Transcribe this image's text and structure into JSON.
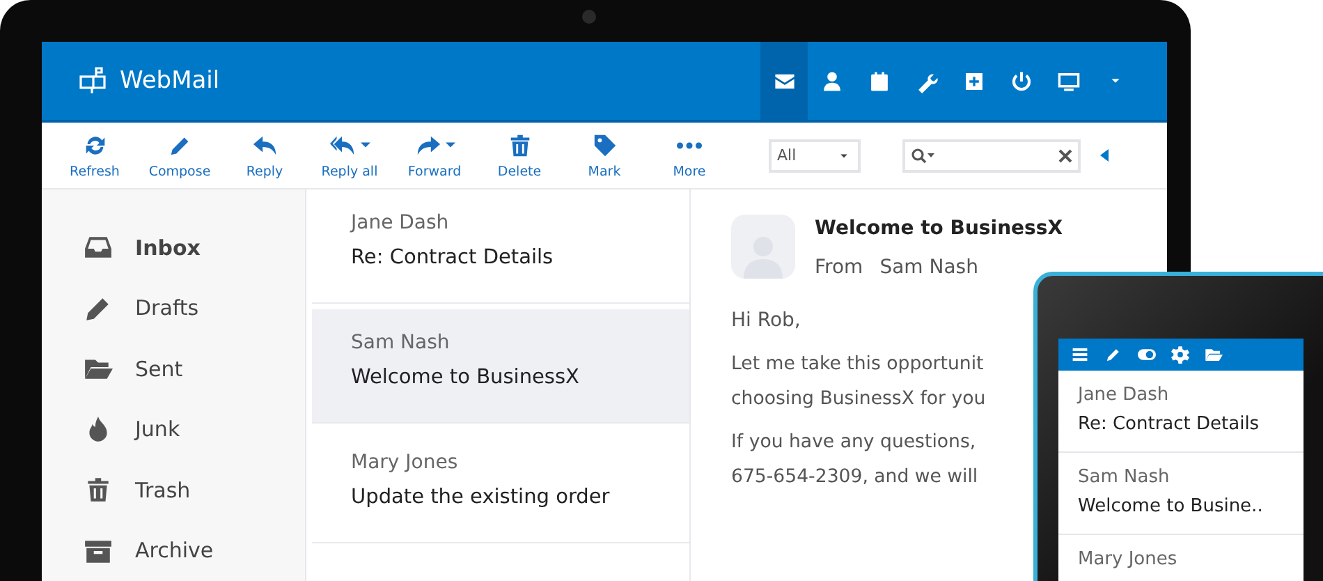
{
  "app": {
    "title": "WebMail"
  },
  "nav_icons": [
    {
      "kind": "mail",
      "selected": true
    },
    {
      "kind": "person",
      "selected": false
    },
    {
      "kind": "calendar",
      "selected": false
    },
    {
      "kind": "wrench",
      "selected": false
    },
    {
      "kind": "plus",
      "selected": false
    },
    {
      "kind": "power",
      "selected": false
    },
    {
      "kind": "monitor",
      "selected": false
    },
    {
      "kind": "caret",
      "selected": false
    }
  ],
  "toolbar": [
    {
      "kind": "refresh",
      "label": "Refresh",
      "dropdown": false
    },
    {
      "kind": "compose",
      "label": "Compose",
      "dropdown": false
    },
    {
      "kind": "reply",
      "label": "Reply",
      "dropdown": false
    },
    {
      "kind": "replyall",
      "label": "Reply all",
      "dropdown": true
    },
    {
      "kind": "forward",
      "label": "Forward",
      "dropdown": true
    },
    {
      "kind": "delete",
      "label": "Delete",
      "dropdown": false
    },
    {
      "kind": "mark",
      "label": "Mark",
      "dropdown": false
    },
    {
      "kind": "more",
      "label": "More",
      "dropdown": false
    }
  ],
  "filter": {
    "value": "All"
  },
  "folders": [
    {
      "kind": "inbox",
      "label": "Inbox",
      "selected": true
    },
    {
      "kind": "drafts",
      "label": "Drafts",
      "selected": false
    },
    {
      "kind": "sent",
      "label": "Sent",
      "selected": false
    },
    {
      "kind": "junk",
      "label": "Junk",
      "selected": false
    },
    {
      "kind": "trash",
      "label": "Trash",
      "selected": false
    },
    {
      "kind": "archive",
      "label": "Archive",
      "selected": false
    }
  ],
  "messages": [
    {
      "sender": "Jane Dash",
      "subject": "Re: Contract Details",
      "selected": false
    },
    {
      "sender": "Sam Nash",
      "subject": "Welcome to BusinessX",
      "selected": true
    },
    {
      "sender": "Mary Jones",
      "subject": "Update the existing order",
      "selected": false
    }
  ],
  "reading": {
    "subject": "Welcome to BusinessX",
    "from_label": "From",
    "from": "Sam Nash",
    "greeting": "Hi Rob,",
    "paragraphs": [
      [
        "Let me take this opportunit",
        "choosing BusinessX for you"
      ],
      [
        "If you have any questions,",
        "675-654-2309, and we will"
      ]
    ]
  },
  "phone": {
    "messages": [
      {
        "sender": "Jane Dash",
        "subject": "Re: Contract Details"
      },
      {
        "sender": "Sam Nash",
        "subject": "Welcome to Busine.."
      },
      {
        "sender": "Mary Jones"
      }
    ]
  }
}
